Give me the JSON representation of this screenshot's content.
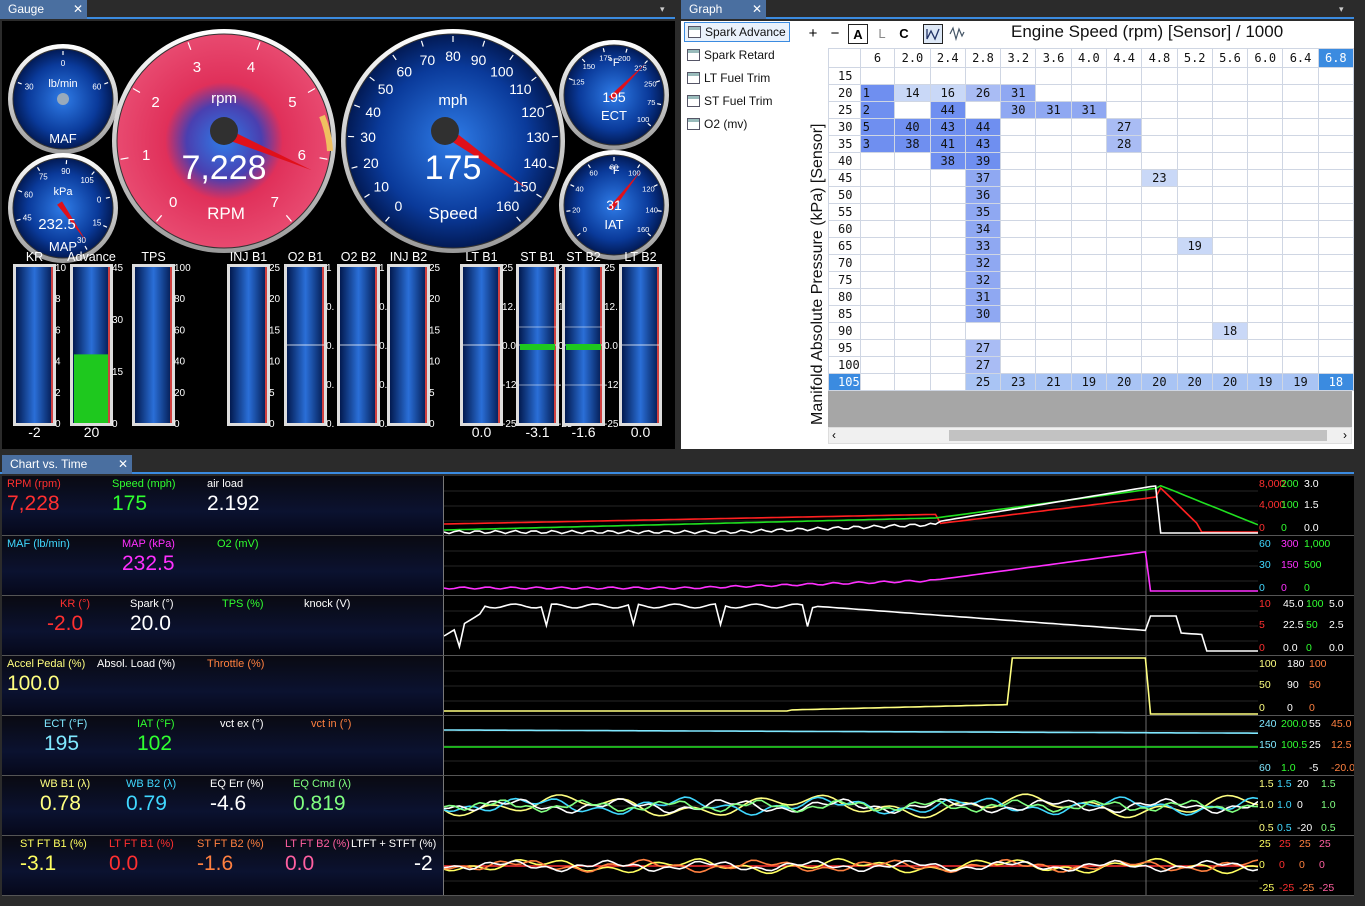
{
  "tabs": {
    "gauge": "Gauge",
    "graph": "Graph",
    "chart": "Chart vs. Time",
    "close": "✕",
    "dropdown": "▾"
  },
  "gauges": {
    "maf": {
      "top": "lb/min",
      "label": "MAF",
      "ticks": [
        "30",
        "0",
        "60"
      ]
    },
    "map": {
      "top": "kPa",
      "value": "232.5",
      "label": "MAP",
      "ticks": [
        "45",
        "60",
        "75",
        "90",
        "105",
        "0",
        "15",
        "30"
      ]
    },
    "rpm": {
      "unit": "rpm",
      "value": "7,228",
      "label": "RPM",
      "ticks": [
        "0",
        "1",
        "2",
        "3",
        "4",
        "5",
        "6",
        "7"
      ],
      "level": 7228,
      "max": 8000
    },
    "speed": {
      "unit": "mph",
      "value": "175",
      "label": "Speed",
      "ticks": [
        "0",
        "10",
        "20",
        "30",
        "40",
        "50",
        "60",
        "70",
        "80",
        "90",
        "100",
        "110",
        "120",
        "130",
        "140",
        "150",
        "160"
      ],
      "level": 175
    },
    "ect": {
      "top": "°F",
      "value": "195",
      "label": "ECT",
      "ticks": [
        "125",
        "150",
        "175",
        "200",
        "225",
        "250",
        "75",
        "100"
      ]
    },
    "iat": {
      "top": "°F",
      "value": "31",
      "label": "IAT",
      "ticks": [
        "0",
        "20",
        "40",
        "60",
        "80",
        "100",
        "120",
        "140",
        "160"
      ]
    }
  },
  "bars": [
    {
      "name": "KR",
      "value": "-2",
      "ticks": [
        "10",
        "8",
        "6",
        "4",
        "2",
        "0"
      ],
      "fill": 0
    },
    {
      "name": "Advance",
      "value": "20",
      "ticks": [
        "45",
        "30",
        "15",
        "0"
      ],
      "fill": 0.44
    },
    {
      "name": "TPS",
      "value": "",
      "ticks": [
        "100",
        "80",
        "60",
        "40",
        "20",
        "0"
      ],
      "fill": 0
    },
    {
      "name": "INJ B1",
      "value": "",
      "ticks": [
        "25",
        "20",
        "15",
        "10",
        "5",
        "0"
      ],
      "fill": 0
    },
    {
      "name": "O2 B1",
      "value": "",
      "ticks": [
        "1",
        "0.",
        "0.",
        "0.",
        "0."
      ],
      "fill": 0
    },
    {
      "name": "O2 B2",
      "value": "",
      "ticks": [
        "1",
        "0.",
        "0.",
        "0.",
        "0."
      ],
      "fill": 0
    },
    {
      "name": "INJ B2",
      "value": "",
      "ticks": [
        "25",
        "20",
        "15",
        "10",
        "5",
        "0"
      ],
      "fill": 0
    },
    {
      "name": "LT B1",
      "value": "0.0",
      "ticks": [
        "25",
        "12.",
        "0.0",
        "-12",
        "-25"
      ],
      "fill": 0
    },
    {
      "name": "ST B1",
      "value": "-3.1",
      "ticks": [
        "25",
        "12.",
        "0.0",
        "-12",
        "-25"
      ],
      "fill": 0
    },
    {
      "name": "ST B2",
      "value": "-1.6",
      "ticks": [
        "25",
        "12.",
        "0.0",
        "-12",
        "-25"
      ],
      "fill": 0
    },
    {
      "name": "LT B2",
      "value": "0.0",
      "ticks": [
        "",
        "",
        "",
        "",
        ""
      ],
      "fill": 0
    }
  ],
  "graph": {
    "tree": [
      "Spark Advance",
      "Spark Retard",
      "LT Fuel Trim",
      "ST Fuel Trim",
      "O2 (mv)"
    ],
    "toolbar": {
      "plus": "+",
      "minus": "−",
      "a": "A",
      "l": "L",
      "c": "C"
    },
    "x_title": "Engine Speed (rpm) [Sensor] / 1000",
    "y_title": "Manifold Absolute Pressure (kPa) [Sensor]",
    "cols": [
      "6",
      "2.0",
      "2.4",
      "2.8",
      "3.2",
      "3.6",
      "4.0",
      "4.4",
      "4.8",
      "5.2",
      "5.6",
      "6.0",
      "6.4",
      "6.8"
    ],
    "rows": [
      {
        "k": "15",
        "c": [
          "",
          "",
          "",
          "",
          "",
          "",
          "",
          "",
          "",
          "",
          "",
          "",
          "",
          ""
        ]
      },
      {
        "k": "20",
        "c": [
          "1",
          "14",
          "16",
          "26",
          "31",
          "",
          "",
          "",
          "",
          "",
          "",
          "",
          "",
          ""
        ]
      },
      {
        "k": "25",
        "c": [
          "2",
          "",
          "44",
          "",
          "30",
          "31",
          "31",
          "",
          "",
          "",
          "",
          "",
          "",
          ""
        ]
      },
      {
        "k": "30",
        "c": [
          "5",
          "40",
          "43",
          "44",
          "",
          "",
          "",
          "27",
          "",
          "",
          "",
          "",
          "",
          ""
        ]
      },
      {
        "k": "35",
        "c": [
          "3",
          "38",
          "41",
          "43",
          "",
          "",
          "",
          "28",
          "",
          "",
          "",
          "",
          "",
          ""
        ]
      },
      {
        "k": "40",
        "c": [
          "",
          "",
          "38",
          "39",
          "",
          "",
          "",
          "",
          "",
          "",
          "",
          "",
          "",
          ""
        ]
      },
      {
        "k": "45",
        "c": [
          "",
          "",
          "",
          "37",
          "",
          "",
          "",
          "",
          "23",
          "",
          "",
          "",
          "",
          ""
        ]
      },
      {
        "k": "50",
        "c": [
          "",
          "",
          "",
          "36",
          "",
          "",
          "",
          "",
          "",
          "",
          "",
          "",
          "",
          ""
        ]
      },
      {
        "k": "55",
        "c": [
          "",
          "",
          "",
          "35",
          "",
          "",
          "",
          "",
          "",
          "",
          "",
          "",
          "",
          ""
        ]
      },
      {
        "k": "60",
        "c": [
          "",
          "",
          "",
          "34",
          "",
          "",
          "",
          "",
          "",
          "",
          "",
          "",
          "",
          ""
        ]
      },
      {
        "k": "65",
        "c": [
          "",
          "",
          "",
          "33",
          "",
          "",
          "",
          "",
          "",
          "19",
          "",
          "",
          "",
          ""
        ]
      },
      {
        "k": "70",
        "c": [
          "",
          "",
          "",
          "32",
          "",
          "",
          "",
          "",
          "",
          "",
          "",
          "",
          "",
          ""
        ]
      },
      {
        "k": "75",
        "c": [
          "",
          "",
          "",
          "32",
          "",
          "",
          "",
          "",
          "",
          "",
          "",
          "",
          "",
          ""
        ]
      },
      {
        "k": "80",
        "c": [
          "",
          "",
          "",
          "31",
          "",
          "",
          "",
          "",
          "",
          "",
          "",
          "",
          "",
          ""
        ]
      },
      {
        "k": "85",
        "c": [
          "",
          "",
          "",
          "30",
          "",
          "",
          "",
          "",
          "",
          "",
          "",
          "",
          "",
          ""
        ]
      },
      {
        "k": "90",
        "c": [
          "",
          "",
          "",
          "",
          "",
          "",
          "",
          "",
          "",
          "",
          "18",
          "",
          "",
          ""
        ]
      },
      {
        "k": "95",
        "c": [
          "",
          "",
          "",
          "27",
          "",
          "",
          "",
          "",
          "",
          "",
          "",
          "",
          "",
          ""
        ]
      },
      {
        "k": "100",
        "c": [
          "",
          "",
          "",
          "27",
          "",
          "",
          "",
          "",
          "",
          "",
          "",
          "",
          "",
          ""
        ]
      },
      {
        "k": "105",
        "c": [
          "",
          "",
          "",
          "25",
          "23",
          "21",
          "19",
          "20",
          "20",
          "20",
          "20",
          "19",
          "19",
          "18"
        ]
      }
    ],
    "selected_col": "6.8",
    "selected_row": "105"
  },
  "chart_rows": [
    {
      "labels": [
        {
          "t": "RPM (rpm)",
          "c": "#ff3030"
        },
        {
          "t": "Speed (mph)",
          "c": "#30ff30"
        },
        {
          "t": "air load",
          "c": "#ffffff"
        }
      ],
      "values": [
        {
          "t": "7,228",
          "c": "#ff3030"
        },
        {
          "t": "175",
          "c": "#30ff30"
        },
        {
          "t": "2.192",
          "c": "#ffffff"
        }
      ],
      "scale": [
        [
          {
            "t": "8,000",
            "c": "#ff3030"
          },
          {
            "t": "200",
            "c": "#30ff30"
          },
          {
            "t": "3.0",
            "c": "#fff"
          }
        ],
        [
          {
            "t": "4,000",
            "c": "#ff3030"
          },
          {
            "t": "100",
            "c": "#30ff30"
          },
          {
            "t": "1.5",
            "c": "#fff"
          }
        ],
        [
          {
            "t": "0",
            "c": "#ff3030"
          },
          {
            "t": "0",
            "c": "#30ff30"
          },
          {
            "t": "0.0",
            "c": "#fff"
          }
        ]
      ]
    },
    {
      "labels": [
        {
          "t": "MAF (lb/min)",
          "c": "#40d8ff"
        },
        {
          "t": "MAP (kPa)",
          "c": "#ff30ff"
        },
        {
          "t": "O2 (mV)",
          "c": "#30ff30"
        }
      ],
      "values": [
        {
          "t": "",
          "c": "#40d8ff"
        },
        {
          "t": "232.5",
          "c": "#ff30ff"
        },
        {
          "t": "",
          "c": "#30ff30"
        }
      ],
      "scale": [
        [
          {
            "t": "60",
            "c": "#40d8ff"
          },
          {
            "t": "300",
            "c": "#ff30ff"
          },
          {
            "t": "1,000",
            "c": "#30ff30"
          }
        ],
        [
          {
            "t": "30",
            "c": "#40d8ff"
          },
          {
            "t": "150",
            "c": "#ff30ff"
          },
          {
            "t": "500",
            "c": "#30ff30"
          }
        ],
        [
          {
            "t": "0",
            "c": "#40d8ff"
          },
          {
            "t": "0",
            "c": "#ff30ff"
          },
          {
            "t": "0",
            "c": "#30ff30"
          }
        ]
      ]
    },
    {
      "labels": [
        {
          "t": "KR (°)",
          "c": "#ff3030"
        },
        {
          "t": "Spark (°)",
          "c": "#ffffff"
        },
        {
          "t": "TPS (%)",
          "c": "#30ff30"
        },
        {
          "t": "knock (V)",
          "c": "#ffffff"
        }
      ],
      "values": [
        {
          "t": "-2.0",
          "c": "#ff3030"
        },
        {
          "t": "20.0",
          "c": "#ffffff"
        },
        {
          "t": "",
          "c": "#30ff30"
        },
        {
          "t": "",
          "c": "#fff"
        }
      ],
      "scale": [
        [
          {
            "t": "10",
            "c": "#ff3030"
          },
          {
            "t": "45.0",
            "c": "#fff"
          },
          {
            "t": "100",
            "c": "#30ff30"
          },
          {
            "t": "5.0",
            "c": "#fff"
          }
        ],
        [
          {
            "t": "5",
            "c": "#ff3030"
          },
          {
            "t": "22.5",
            "c": "#fff"
          },
          {
            "t": "50",
            "c": "#30ff30"
          },
          {
            "t": "2.5",
            "c": "#fff"
          }
        ],
        [
          {
            "t": "0",
            "c": "#ff3030"
          },
          {
            "t": "0.0",
            "c": "#fff"
          },
          {
            "t": "0",
            "c": "#30ff30"
          },
          {
            "t": "0.0",
            "c": "#fff"
          }
        ]
      ]
    },
    {
      "labels": [
        {
          "t": "Accel Pedal (%)",
          "c": "#ffff80"
        },
        {
          "t": "Absol. Load (%)",
          "c": "#ffffff"
        },
        {
          "t": "Throttle (%)",
          "c": "#ff8040"
        }
      ],
      "values": [
        {
          "t": "100.0",
          "c": "#ffff80"
        },
        {
          "t": "",
          "c": "#fff"
        },
        {
          "t": "",
          "c": "#ff8040"
        }
      ],
      "scale": [
        [
          {
            "t": "100",
            "c": "#ffff80"
          },
          {
            "t": "180",
            "c": "#fff"
          },
          {
            "t": "100",
            "c": "#ff8040"
          }
        ],
        [
          {
            "t": "50",
            "c": "#ffff80"
          },
          {
            "t": "90",
            "c": "#fff"
          },
          {
            "t": "50",
            "c": "#ff8040"
          }
        ],
        [
          {
            "t": "0",
            "c": "#ffff80"
          },
          {
            "t": "0",
            "c": "#fff"
          },
          {
            "t": "0",
            "c": "#ff8040"
          }
        ]
      ]
    },
    {
      "labels": [
        {
          "t": "ECT (°F)",
          "c": "#80e8ff"
        },
        {
          "t": "IAT (°F)",
          "c": "#30ff30"
        },
        {
          "t": "vct ex (°)",
          "c": "#ffffff"
        },
        {
          "t": "vct in (°)",
          "c": "#ff8040"
        }
      ],
      "values": [
        {
          "t": "195",
          "c": "#80e8ff"
        },
        {
          "t": "102",
          "c": "#30ff30"
        },
        {
          "t": "",
          "c": "#fff"
        },
        {
          "t": "",
          "c": "#ff8040"
        }
      ],
      "scale": [
        [
          {
            "t": "240",
            "c": "#80e8ff"
          },
          {
            "t": "200.0",
            "c": "#30ff30"
          },
          {
            "t": "55",
            "c": "#fff"
          },
          {
            "t": "45.0",
            "c": "#ff8040"
          }
        ],
        [
          {
            "t": "150",
            "c": "#80e8ff"
          },
          {
            "t": "100.5",
            "c": "#30ff30"
          },
          {
            "t": "25",
            "c": "#fff"
          },
          {
            "t": "12.5",
            "c": "#ff8040"
          }
        ],
        [
          {
            "t": "60",
            "c": "#80e8ff"
          },
          {
            "t": "1.0",
            "c": "#30ff30"
          },
          {
            "t": "-5",
            "c": "#fff"
          },
          {
            "t": "-20.0",
            "c": "#ff8040"
          }
        ]
      ]
    },
    {
      "labels": [
        {
          "t": "WB B1 (λ)",
          "c": "#ffff80"
        },
        {
          "t": "WB B2 (λ)",
          "c": "#40d8ff"
        },
        {
          "t": "EQ Err (%)",
          "c": "#ffffff"
        },
        {
          "t": "EQ Cmd (λ)",
          "c": "#80ff80"
        }
      ],
      "values": [
        {
          "t": "0.78",
          "c": "#ffff80"
        },
        {
          "t": "0.79",
          "c": "#40d8ff"
        },
        {
          "t": "-4.6",
          "c": "#ffffff"
        },
        {
          "t": "0.819",
          "c": "#80ff80"
        }
      ],
      "scale": [
        [
          {
            "t": "1.5",
            "c": "#ffff80"
          },
          {
            "t": "1.5",
            "c": "#40d8ff"
          },
          {
            "t": "20",
            "c": "#fff"
          },
          {
            "t": "1.5",
            "c": "#80ff80"
          }
        ],
        [
          {
            "t": "1.0",
            "c": "#ffff80"
          },
          {
            "t": "1.0",
            "c": "#40d8ff"
          },
          {
            "t": "0",
            "c": "#fff"
          },
          {
            "t": "1.0",
            "c": "#80ff80"
          }
        ],
        [
          {
            "t": "0.5",
            "c": "#ffff80"
          },
          {
            "t": "0.5",
            "c": "#40d8ff"
          },
          {
            "t": "-20",
            "c": "#fff"
          },
          {
            "t": "0.5",
            "c": "#80ff80"
          }
        ]
      ]
    },
    {
      "labels": [
        {
          "t": "ST FT B1 (%)",
          "c": "#ffff60"
        },
        {
          "t": "LT FT B1 (%)",
          "c": "#ff3030"
        },
        {
          "t": "ST FT B2 (%)",
          "c": "#ff8040"
        },
        {
          "t": "LT FT B2 (%)",
          "c": "#ff60a0"
        },
        {
          "t": "LTFT + STFT (%)",
          "c": "#ffffff"
        }
      ],
      "values": [
        {
          "t": "-3.1",
          "c": "#ffff60"
        },
        {
          "t": "0.0",
          "c": "#ff3030"
        },
        {
          "t": "-1.6",
          "c": "#ff8040"
        },
        {
          "t": "0.0",
          "c": "#ff60a0"
        },
        {
          "t": "-2",
          "c": "#ffffff"
        }
      ],
      "scale": [
        [
          {
            "t": "25",
            "c": "#ffff60"
          },
          {
            "t": "25",
            "c": "#ff3030"
          },
          {
            "t": "25",
            "c": "#ff8040"
          },
          {
            "t": "25",
            "c": "#ff60a0"
          }
        ],
        [
          {
            "t": "0",
            "c": "#ffff60"
          },
          {
            "t": "0",
            "c": "#ff3030"
          },
          {
            "t": "0",
            "c": "#ff8040"
          },
          {
            "t": "0",
            "c": "#ff60a0"
          }
        ],
        [
          {
            "t": "-25",
            "c": "#ffff60"
          },
          {
            "t": "-25",
            "c": "#ff3030"
          },
          {
            "t": "-25",
            "c": "#ff8040"
          },
          {
            "t": "-25",
            "c": "#ff60a0"
          }
        ]
      ]
    }
  ]
}
